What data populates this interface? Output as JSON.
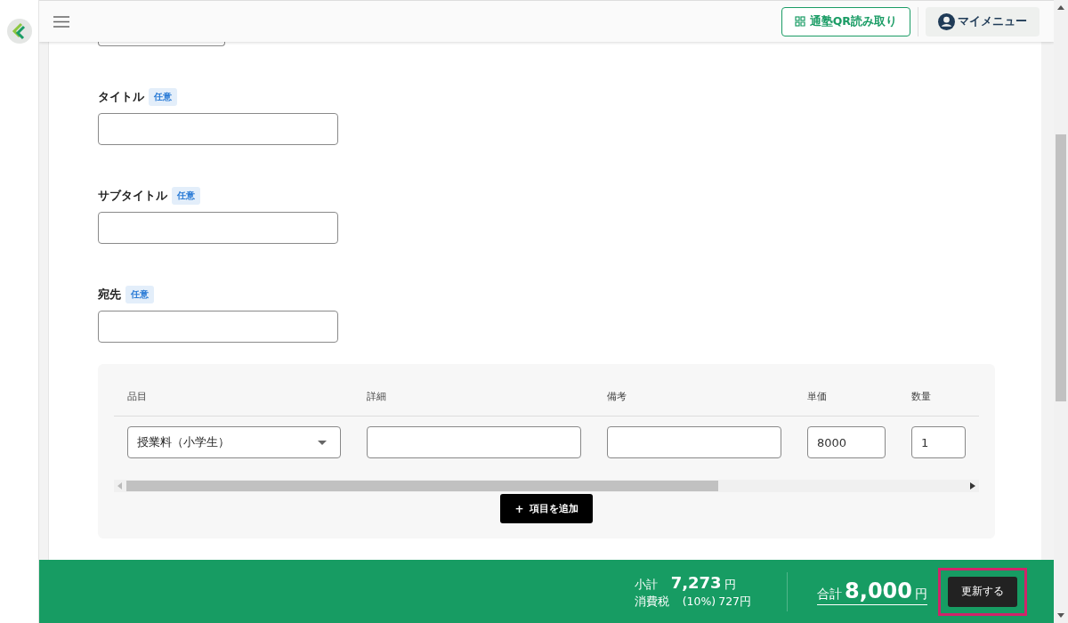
{
  "header": {
    "qr_button": "通塾QR読み取り",
    "my_menu": "マイメニュー"
  },
  "fields": [
    {
      "kind": "partial"
    },
    {
      "kind": "text",
      "label": "タイトル",
      "badge": "任意"
    },
    {
      "kind": "text",
      "label": "サブタイトル",
      "badge": "任意"
    },
    {
      "kind": "text",
      "label": "宛先",
      "badge": "任意"
    }
  ],
  "items_table": {
    "columns": [
      "品目",
      "詳細",
      "備考",
      "単価",
      "数量"
    ],
    "rows": [
      [
        {
          "kind": "select",
          "value": "授業料（小学生）"
        },
        {
          "kind": "input"
        },
        {
          "kind": "input"
        },
        {
          "kind": "input",
          "value": "8000"
        },
        {
          "kind": "input",
          "value": "1"
        }
      ]
    ],
    "add_button": {
      "icon": "+",
      "label": "項目を追加"
    }
  },
  "footer": {
    "subtotal_label": "小計",
    "subtotal": "7,273",
    "subtotal_unit": "円",
    "tax_label": "消費税",
    "tax_rate": "(10%)",
    "tax": "727円",
    "total_label": "合計",
    "total": "8,000",
    "total_unit": "円",
    "update_button": "更新する",
    "update_highlighted": true
  }
}
